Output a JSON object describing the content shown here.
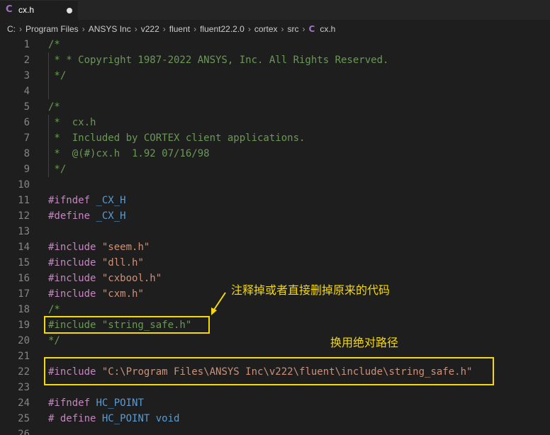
{
  "tab": {
    "icon": "C",
    "label": "cx.h",
    "modified": true
  },
  "breadcrumb": [
    "C:",
    "Program Files",
    "ANSYS Inc",
    "v222",
    "fluent",
    "fluent22.2.0",
    "cortex",
    "src"
  ],
  "breadcrumb_file": {
    "icon": "C",
    "label": "cx.h"
  },
  "lines": [
    {
      "n": "1",
      "tokens": [
        {
          "t": "/*",
          "c": "comment"
        }
      ]
    },
    {
      "n": "2",
      "tokens": [
        {
          "t": " * * Copyright 1987-2022 ANSYS, Inc. All Rights Reserved.",
          "c": "comment"
        }
      ]
    },
    {
      "n": "3",
      "tokens": [
        {
          "t": " */",
          "c": "comment"
        }
      ]
    },
    {
      "n": "4",
      "tokens": []
    },
    {
      "n": "5",
      "tokens": [
        {
          "t": "/*",
          "c": "comment"
        }
      ]
    },
    {
      "n": "6",
      "tokens": [
        {
          "t": " *  cx.h",
          "c": "comment"
        }
      ]
    },
    {
      "n": "7",
      "tokens": [
        {
          "t": " *  Included by CORTEX client applications.",
          "c": "comment"
        }
      ]
    },
    {
      "n": "8",
      "tokens": [
        {
          "t": " *  @(#)cx.h  1.92 07/16/98",
          "c": "comment"
        }
      ]
    },
    {
      "n": "9",
      "tokens": [
        {
          "t": " */",
          "c": "comment"
        }
      ]
    },
    {
      "n": "10",
      "tokens": []
    },
    {
      "n": "11",
      "tokens": [
        {
          "t": "#ifndef",
          "c": "pre"
        },
        {
          "t": " ",
          "c": "plain"
        },
        {
          "t": "_CX_H",
          "c": "macro"
        }
      ]
    },
    {
      "n": "12",
      "tokens": [
        {
          "t": "#define",
          "c": "pre"
        },
        {
          "t": " ",
          "c": "plain"
        },
        {
          "t": "_CX_H",
          "c": "macro"
        }
      ]
    },
    {
      "n": "13",
      "tokens": []
    },
    {
      "n": "14",
      "tokens": [
        {
          "t": "#include",
          "c": "pre"
        },
        {
          "t": " ",
          "c": "plain"
        },
        {
          "t": "\"seem.h\"",
          "c": "str"
        }
      ]
    },
    {
      "n": "15",
      "tokens": [
        {
          "t": "#include",
          "c": "pre"
        },
        {
          "t": " ",
          "c": "plain"
        },
        {
          "t": "\"dll.h\"",
          "c": "str"
        }
      ]
    },
    {
      "n": "16",
      "tokens": [
        {
          "t": "#include",
          "c": "pre"
        },
        {
          "t": " ",
          "c": "plain"
        },
        {
          "t": "\"cxbool.h\"",
          "c": "str"
        }
      ]
    },
    {
      "n": "17",
      "tokens": [
        {
          "t": "#include",
          "c": "pre"
        },
        {
          "t": " ",
          "c": "plain"
        },
        {
          "t": "\"cxm.h\"",
          "c": "str"
        }
      ]
    },
    {
      "n": "18",
      "tokens": [
        {
          "t": "/*",
          "c": "comment"
        }
      ]
    },
    {
      "n": "19",
      "tokens": [
        {
          "t": "#include \"string_safe.h\"",
          "c": "comment"
        }
      ]
    },
    {
      "n": "20",
      "tokens": [
        {
          "t": "*/",
          "c": "comment"
        }
      ]
    },
    {
      "n": "21",
      "tokens": []
    },
    {
      "n": "22",
      "tokens": [
        {
          "t": "#include",
          "c": "pre"
        },
        {
          "t": " ",
          "c": "plain"
        },
        {
          "t": "\"C:\\Program Files\\ANSYS Inc\\v222\\fluent\\include\\string_safe.h\"",
          "c": "str"
        }
      ]
    },
    {
      "n": "23",
      "tokens": []
    },
    {
      "n": "24",
      "tokens": [
        {
          "t": "#ifndef",
          "c": "pre"
        },
        {
          "t": " ",
          "c": "plain"
        },
        {
          "t": "HC_POINT",
          "c": "macro"
        }
      ]
    },
    {
      "n": "25",
      "tokens": [
        {
          "t": "# define",
          "c": "pre"
        },
        {
          "t": " ",
          "c": "plain"
        },
        {
          "t": "HC_POINT",
          "c": "macro"
        },
        {
          "t": " ",
          "c": "plain"
        },
        {
          "t": "void",
          "c": "kw"
        }
      ]
    },
    {
      "n": "26",
      "tokens": []
    }
  ],
  "annotations": {
    "note1": "注释掉或者直接删掉原来的代码",
    "note2": "换用绝对路径"
  },
  "colors": {
    "background": "#1e1e1e",
    "comment": "#6a9955",
    "preprocessor": "#c586c0",
    "macro": "#569cd6",
    "string": "#ce9178",
    "annotation": "#f5d90a"
  }
}
